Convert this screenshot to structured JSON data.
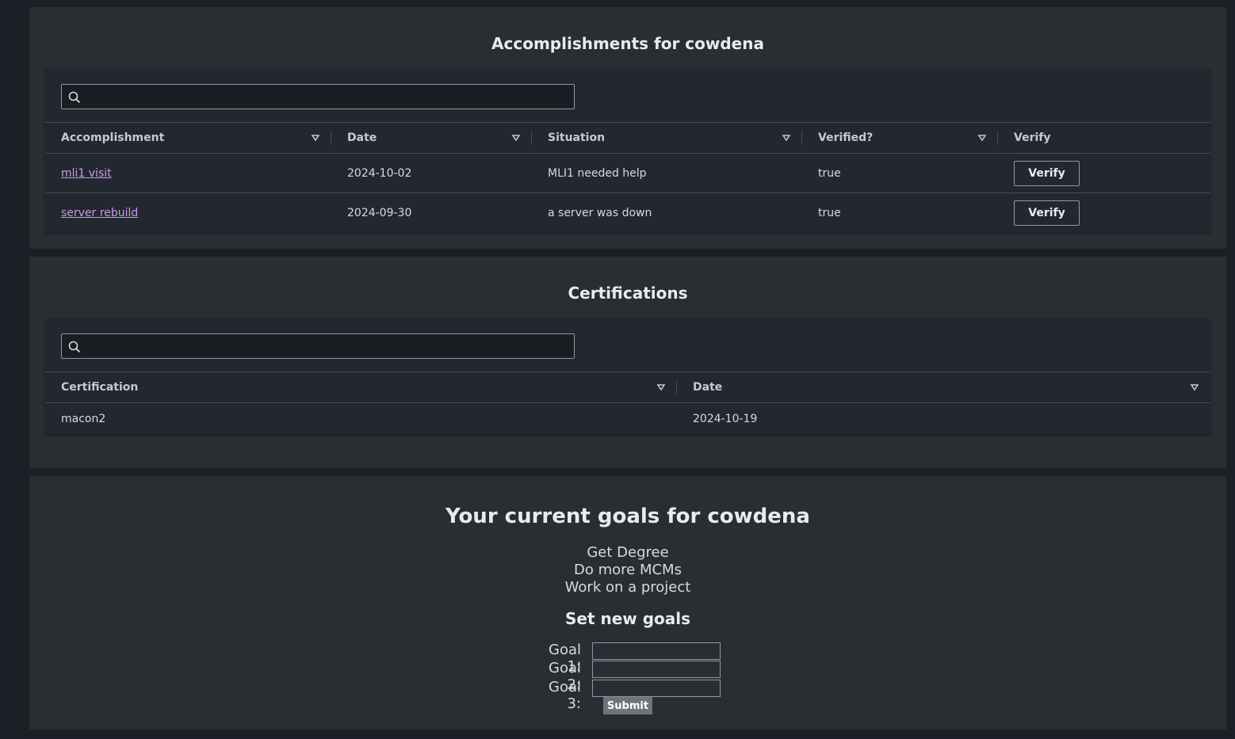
{
  "accomplishments": {
    "title": "Accomplishments for cowdena",
    "search_placeholder": "",
    "columns": [
      "Accomplishment",
      "Date",
      "Situation",
      "Verified?",
      "Verify"
    ],
    "rows": [
      {
        "accomplishment": "mli1 visit",
        "date": "2024-10-02",
        "situation": "MLI1 needed help",
        "verified": "true",
        "action": "Verify"
      },
      {
        "accomplishment": "server rebuild",
        "date": "2024-09-30",
        "situation": "a server was down",
        "verified": "true",
        "action": "Verify"
      }
    ]
  },
  "certifications": {
    "title": "Certifications",
    "search_placeholder": "",
    "columns": [
      "Certification",
      "Date"
    ],
    "rows": [
      {
        "certification": "macon2",
        "date": "2024-10-19"
      }
    ]
  },
  "goals": {
    "title": "Your current goals for cowdena",
    "current": [
      "Get Degree",
      "Do more MCMs",
      "Work on a project"
    ],
    "form_title": "Set new goals",
    "labels": [
      "Goal 1:",
      "Goal 2:",
      "Goal 3:"
    ],
    "submit_label": "Submit"
  },
  "icons": {
    "search": "search-icon",
    "sort": "sort-down-icon"
  },
  "colors": {
    "background": "#1b1f26",
    "panel": "#2a2e33",
    "link": "#c69ae8",
    "border": "#414d5c"
  }
}
